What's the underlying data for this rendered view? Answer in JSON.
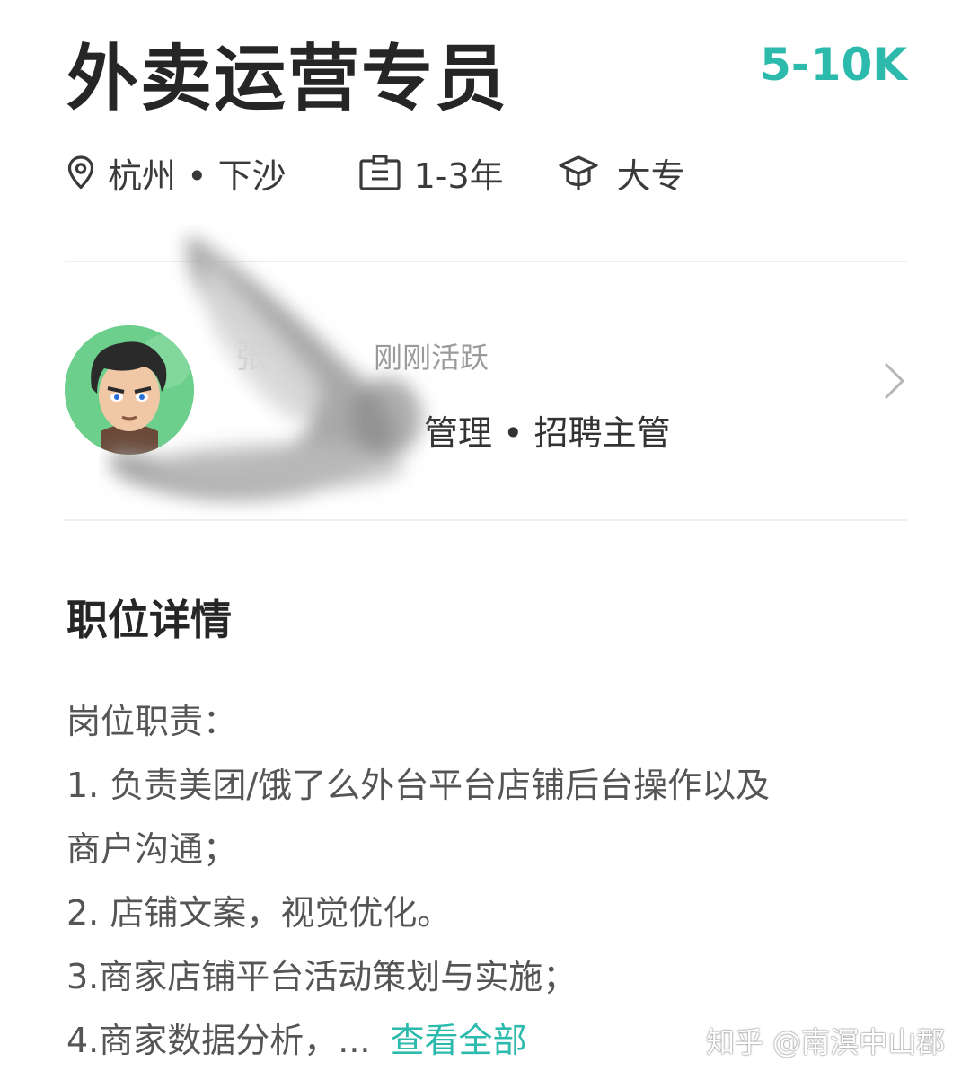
{
  "job": {
    "title": "外卖运营专员",
    "salary": "5-10K",
    "location": "杭州 • 下沙",
    "experience": "1-3年",
    "education": "大专"
  },
  "recruiter": {
    "name": "张",
    "status": "刚刚活跃",
    "role": "管理 • 招聘主管"
  },
  "details": {
    "heading": "职位详情",
    "lines": [
      "岗位职责：",
      "1. 负责美团/饿了么外台平台店铺后台操作以及",
      "商户沟通；",
      "2. 店铺文案，视觉优化。",
      "3.商家店铺平台活动策划与实施；",
      "4.商家数据分析，..."
    ],
    "view_all": "查看全部"
  },
  "watermark": "知乎 @南溟中山郡",
  "colors": {
    "accent": "#2cbaad",
    "title": "#262626",
    "divider": "#eeeeee"
  },
  "icons": {
    "location": "location-pin-icon",
    "experience": "briefcase-icon",
    "education": "graduation-cap-icon",
    "chevron": "chevron-right-icon"
  }
}
